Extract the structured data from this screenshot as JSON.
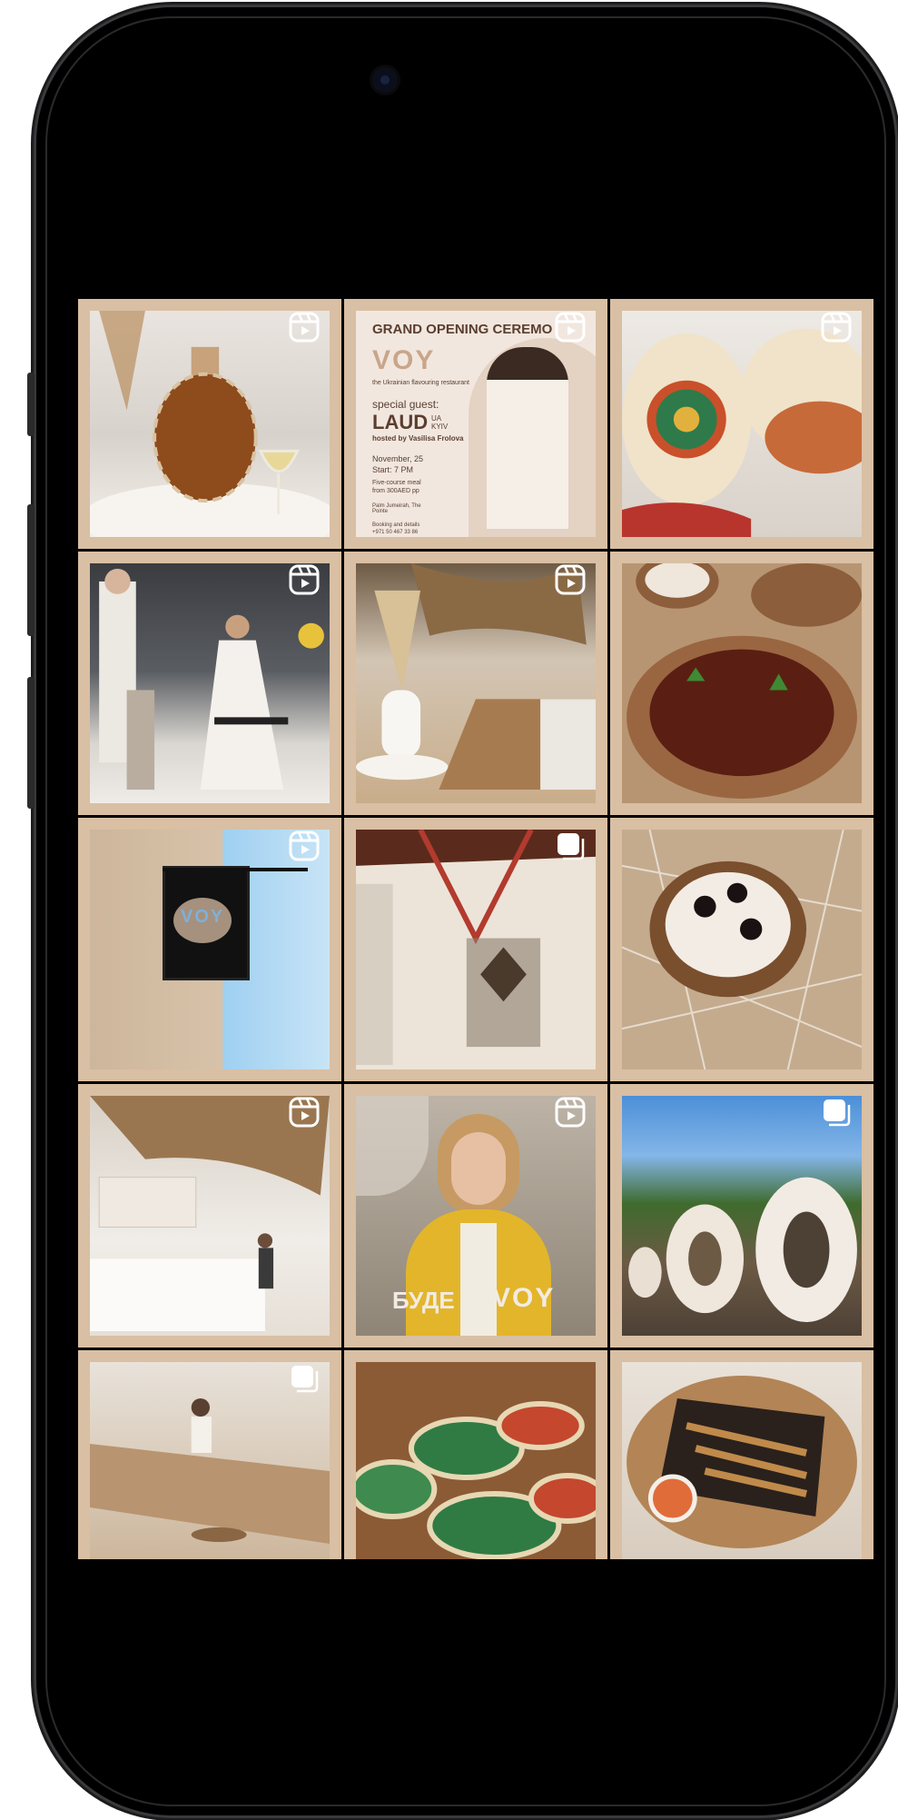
{
  "post_2": {
    "headline": "GRAND OPENING CEREMO",
    "logo": "VOY",
    "tagline": "the Ukrainian flavouring restaurant",
    "guest_label": "special guest:",
    "guest_name": "LAUD",
    "guest_sub": "UA KYIV",
    "hosted_by": "hosted by Vasilisa Frolova",
    "date": "November, 25",
    "start": "Start: 7 PM",
    "meal": "Five-course meal",
    "price": "from 300AED pp",
    "venue": "Palm Jumeirah, The Pointe",
    "booking": "Booking and details",
    "phone": "+971 50 467 33 86"
  },
  "post_11": {
    "caption": "БУДЕ",
    "logo": "VOY"
  },
  "post_7": {
    "sign_logo": "VOY"
  },
  "icons": {
    "reel": "reel-icon",
    "carousel": "carousel-icon"
  },
  "colors": {
    "frame_beige": "#d9bfa3",
    "phone_black": "#000000",
    "brand_brown": "#5b3e2f"
  }
}
